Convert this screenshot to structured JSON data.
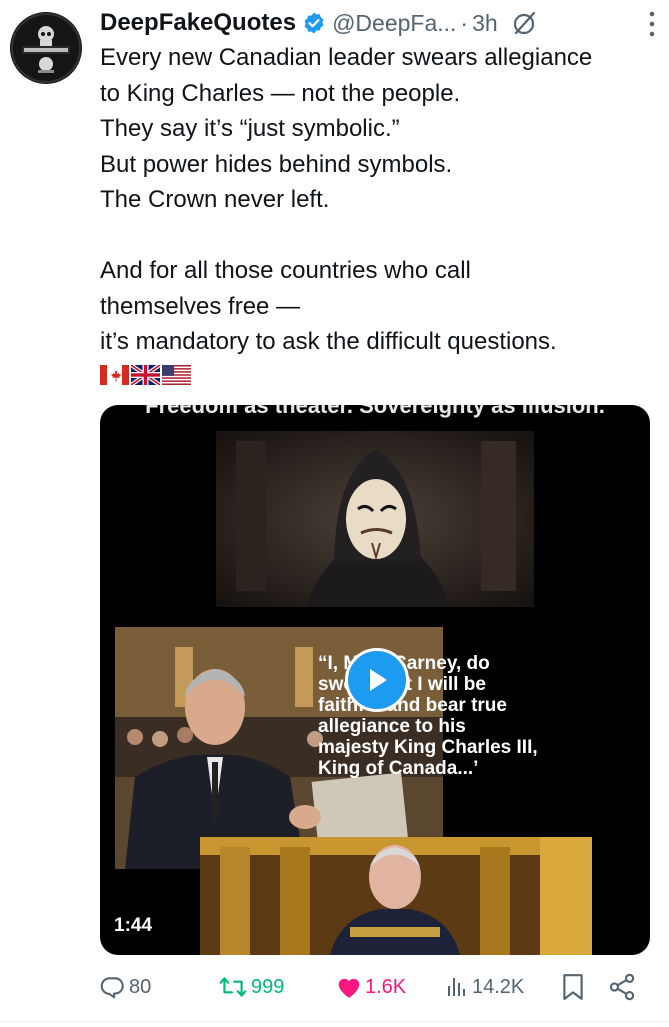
{
  "post": {
    "author_name": "DeepFakeQuotes",
    "handle": "@DeepFa...",
    "time": "3h",
    "text_lines": [
      "Every new Canadian leader swears allegiance",
      "to King Charles — not the people.",
      "They say it’s “just symbolic.”",
      "But power hides behind symbols.",
      "The Crown never left.",
      "",
      "And for all those countries who call",
      "themselves free —",
      "it’s mandatory to ask the difficult questions."
    ],
    "flags": [
      "canada-flag",
      "uk-flag",
      "us-flag"
    ]
  },
  "media": {
    "caption_top": "Freedom as theater. Sovereignty as illusion.",
    "quote_lines": [
      "“I, Mark Carney, do",
      "swear that I will be",
      "faithful and bear true",
      "allegiance to his",
      "majesty King Charles III,",
      "King of Canada...’"
    ],
    "duration": "1:44"
  },
  "actions": {
    "replies": "80",
    "reposts": "999",
    "likes": "1.6K",
    "views": "14.2K"
  },
  "colors": {
    "verified": "#1d9bf0",
    "repost": "#00ba7c",
    "like": "#f91880",
    "muted": "#536471",
    "play_button": "#1d9bf0"
  }
}
